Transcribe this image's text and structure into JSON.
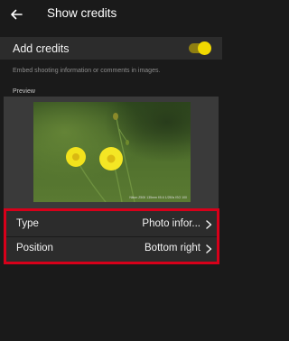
{
  "header": {
    "title": "Show credits",
    "back_icon": "arrow-left-icon"
  },
  "add_credits": {
    "label": "Add credits",
    "enabled": true,
    "accent_color": "#f1d900"
  },
  "description": "Embed shooting information or comments in images.",
  "preview": {
    "label": "Preview",
    "overlay_text": "Nikon Z50II  135mm  f/5.6  1/250s  ISO 100"
  },
  "settings": {
    "type": {
      "label": "Type",
      "value": "Photo infor..."
    },
    "position": {
      "label": "Position",
      "value": "Bottom right"
    },
    "highlight_color": "#d7001a"
  }
}
